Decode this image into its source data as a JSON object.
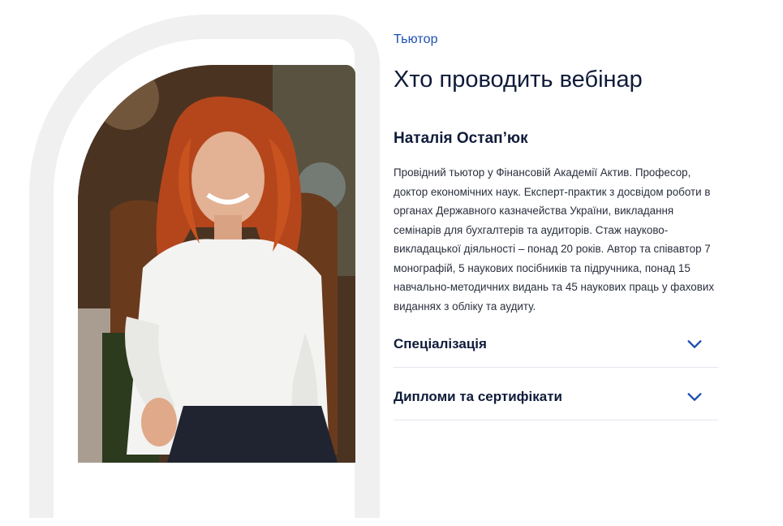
{
  "eyebrow": "Тьютор",
  "title": "Хто проводить вебінар",
  "tutor": {
    "name": "Наталія Остап’юк",
    "bio": "Провідний тьютор у Фінансовій Академії Актив. Професор, доктор економічних наук. Експерт-практик з досвідом роботи в органах Державного казначейства України, викладання семінарів для бухгалтерів та аудиторів. Стаж науково-викладацької діяльності – понад 20 років. Автор та співавтор 7 монографій, 5 наукових посібників та підручника, понад 15 навчально-методичних видань та 45 наукових праць у фахових виданнях з обліку та аудиту."
  },
  "accordion": [
    {
      "label": "Спеціалізація",
      "icon": "chevron-down-icon"
    },
    {
      "label": "Дипломи та сертифікати",
      "icon": "chevron-down-icon"
    }
  ],
  "colors": {
    "accent": "#1c4fb0",
    "heading": "#0f1b3a",
    "frame": "#f0f0f0"
  }
}
